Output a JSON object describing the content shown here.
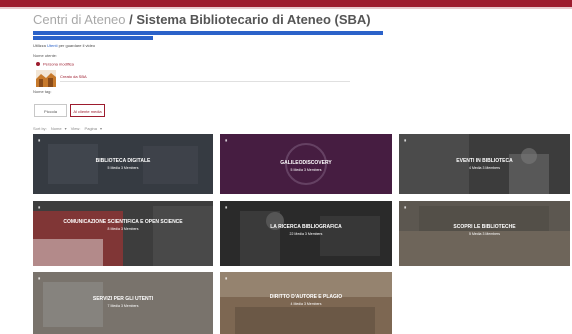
{
  "header": {
    "crumb": "Centri di Ateneo",
    "separator": " / ",
    "current": "Sistema Bibliotecario di Ateneo (SBA)"
  },
  "description": {
    "prefix": "Utilizza ",
    "link": "Utenti",
    "suffix": " per guardare il video"
  },
  "owner": {
    "section_label": "Nome utente:",
    "owner_text": "Persona modifica"
  },
  "creator": {
    "name": "Creato da SBA"
  },
  "tags": {
    "label": "Nome tag:"
  },
  "buttons": {
    "info": "Piccola",
    "all": "Al cliente media"
  },
  "sort": {
    "sort_label": "Sort by: ",
    "sort_value": "Nome",
    "sort_caret": "▾",
    "view_label": "View: ",
    "view_value": "Pagina",
    "view_caret": "▾"
  },
  "tiles": [
    {
      "name": "BIBLIOTECA DIGITALE",
      "meta": "5 Media   3 Members",
      "bg": "#353a40"
    },
    {
      "name": "GALILEODISCOVERY",
      "meta": "5 Media   3 Members",
      "bg": "#3d1f3e",
      "overlay": "GALILEO DISCOVERY"
    },
    {
      "name": "EVENTI IN BIBLIOTECA",
      "meta": "4 Media   3 Members",
      "bg": "#4a4a4a"
    },
    {
      "name": "COMUNICAZIONE SCIENTIFICA E OPEN SCIENCE",
      "meta": "8 Media   3 Members",
      "bg": "#3a3a3a",
      "overlay": "ACCESS"
    },
    {
      "name": "LA RICERCA BIBLIOGRAFICA",
      "meta": "22 Media   3 Members",
      "bg": "#2e2e2e"
    },
    {
      "name": "SCOPRI LE BIBLIOTECHE",
      "meta": "5 Media   3 Members",
      "bg": "#5a5650"
    },
    {
      "name": "SERVIZI PER GLI UTENTI",
      "meta": "7 Media   3 Members",
      "bg": "#6a6a6a"
    },
    {
      "name": "DIRITTO D'AUTORE E PLAGIO",
      "meta": "4 Media   3 Members",
      "bg": "#806a56"
    }
  ]
}
